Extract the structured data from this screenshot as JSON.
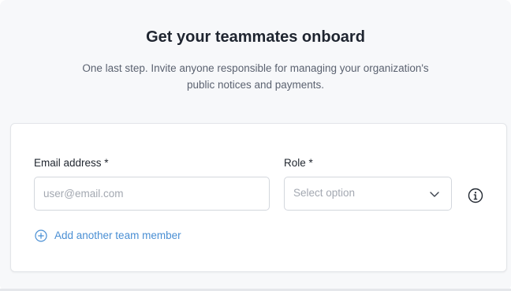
{
  "header": {
    "title": "Get your teammates onboard",
    "subtitle": "One last step. Invite anyone responsible for managing your organization's public notices and payments."
  },
  "form": {
    "email": {
      "label": "Email address *",
      "placeholder": "user@email.com",
      "value": ""
    },
    "role": {
      "label": "Role *",
      "placeholder": "Select option",
      "icon": "chevron-down-icon"
    },
    "info_icon": "info-icon",
    "add_member": {
      "label": "Add another team member",
      "icon": "plus-circle-icon"
    }
  },
  "colors": {
    "background": "#f7f8fa",
    "card": "#ffffff",
    "title": "#1f2530",
    "body_text": "#5b6270",
    "link": "#4a8fd4",
    "placeholder": "#a3a8b1",
    "border": "#d3d7dd"
  }
}
